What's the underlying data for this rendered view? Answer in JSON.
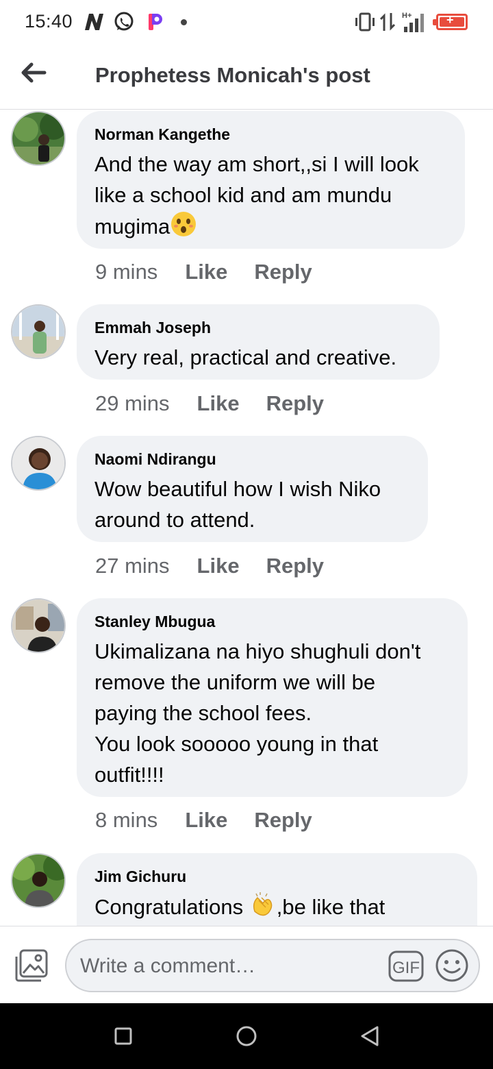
{
  "status_bar": {
    "time": "15:40",
    "icons": [
      "n-app-icon",
      "whatsapp-icon",
      "p-app-icon",
      "notification-dot",
      "vibrate-icon",
      "data-transfer-icon",
      "signal-hplus-icon",
      "battery-charging-icon"
    ],
    "network_label": "H+"
  },
  "header": {
    "title": "Prophetess Monicah's post",
    "back_icon": "arrow-left-icon"
  },
  "comments": [
    {
      "name": "Norman Kangethe",
      "text": "And the way am short,,si I will look\nlike a school kid and am mundu\nmugima",
      "emoji": "😲",
      "time": "9 mins",
      "like": "Like",
      "reply": "Reply"
    },
    {
      "name": "Emmah Joseph",
      "text": "Very real, practical and creative.",
      "time": "29 mins",
      "like": "Like",
      "reply": "Reply"
    },
    {
      "name": "Naomi Ndirangu",
      "text": "Wow beautiful how I wish Niko\naround to attend.",
      "time": "27 mins",
      "like": "Like",
      "reply": "Reply"
    },
    {
      "name": "Stanley Mbugua",
      "text": "Ukimalizana na hiyo shughuli don't\nremove the uniform we will be\npaying the school fees.\nYou look sooooo young in that\noutfit!!!!",
      "time": "8 mins",
      "like": "Like",
      "reply": "Reply"
    },
    {
      "name": "Jim Gichuru",
      "text_before": "Congratulations ",
      "emoji": "👏",
      "text_after": ",be like that"
    }
  ],
  "composer": {
    "placeholder": "Write a comment…",
    "gif_label": "GIF",
    "icons": [
      "photo-icon",
      "gif-icon",
      "emoji-icon"
    ]
  },
  "nav": {
    "icons": [
      "recents-square-icon",
      "home-circle-icon",
      "back-triangle-icon"
    ]
  },
  "colors": {
    "bubble": "#f0f2f5",
    "meta_text": "#65676b",
    "title_text": "#3a3b3f",
    "battery": "#e84c3d"
  }
}
